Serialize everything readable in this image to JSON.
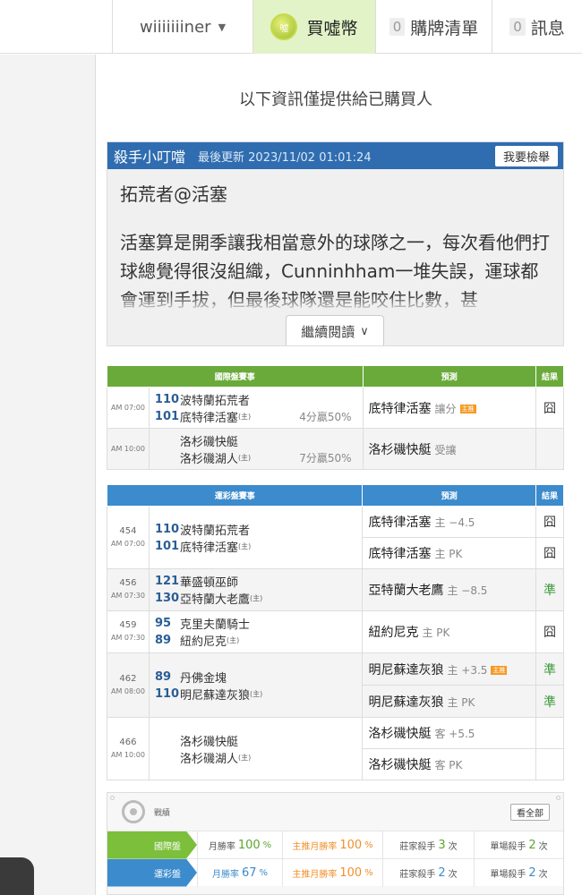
{
  "topbar": {
    "username": "wiiiiiiiner",
    "buy_coin": "買噓幣",
    "coin_icon_text": "噓",
    "list_count": "0",
    "list_label": "購牌清單",
    "msg_count": "0",
    "msg_label": "訊息"
  },
  "notice": "以下資訊僅提供給已購買人",
  "article": {
    "author": "殺手小叮噹",
    "updated": "最後更新 2023/11/02 01:01:24",
    "report": "我要檢舉",
    "title": "拓荒者@活塞",
    "body": "活塞算是開季讓我相當意外的球隊之一，每次看他們打球總覺得很沒組織，Cunninhham一堆失誤，運球都會運到手拔，但最後球隊還是能咬住比數，甚",
    "read_more": "繼續閱讀"
  },
  "intl_table": {
    "headers": [
      "國際盤賽事",
      "預測",
      "結果"
    ],
    "rows": [
      {
        "time": "AM 07:00",
        "away_id": "110",
        "away": "波特蘭拓荒者",
        "home_id": "101",
        "home": "底特律活塞",
        "host": "(主)",
        "odds": "4分贏50%",
        "pick": "底特律活塞",
        "pick_note": "讓分",
        "badge": "主推",
        "result": "囧"
      },
      {
        "time": "AM 10:00",
        "away_id": "",
        "away": "洛杉磯快艇",
        "home_id": "",
        "home": "洛杉磯湖人",
        "host": "(主)",
        "odds": "7分贏50%",
        "pick": "洛杉磯快艇",
        "pick_note": "受讓",
        "badge": "",
        "result": ""
      }
    ]
  },
  "lottery_table": {
    "headers": [
      "運彩盤賽事",
      "預測",
      "結果"
    ],
    "games": [
      {
        "num": "454",
        "time": "AM 07:00",
        "away_id": "110",
        "away": "波特蘭拓荒者",
        "home_id": "101",
        "home": "底特律活塞",
        "host": "(主)",
        "picks": [
          {
            "team": "底特律活塞",
            "note": "主 −4.5",
            "badge": "",
            "result": "囧"
          },
          {
            "team": "底特律活塞",
            "note": "主 PK",
            "badge": "",
            "result": "囧"
          }
        ]
      },
      {
        "num": "456",
        "time": "AM 07:30",
        "away_id": "121",
        "away": "華盛頓巫師",
        "home_id": "130",
        "home": "亞特蘭大老鷹",
        "host": "(主)",
        "picks": [
          {
            "team": "亞特蘭大老鷹",
            "note": "主 −8.5",
            "badge": "",
            "result": "準"
          }
        ]
      },
      {
        "num": "459",
        "time": "AM 07:30",
        "away_id": "95",
        "away": "克里夫蘭騎士",
        "home_id": "89",
        "home": "紐約尼克",
        "host": "(主)",
        "picks": [
          {
            "team": "紐約尼克",
            "note": "主 PK",
            "badge": "",
            "result": "囧"
          }
        ]
      },
      {
        "num": "462",
        "time": "AM 08:00",
        "away_id": "89",
        "away": "丹佛金塊",
        "home_id": "110",
        "home": "明尼蘇達灰狼",
        "host": "(主)",
        "picks": [
          {
            "team": "明尼蘇達灰狼",
            "note": "主 +3.5",
            "badge": "主推",
            "result": "準"
          },
          {
            "team": "明尼蘇達灰狼",
            "note": "主 PK",
            "badge": "",
            "result": "準"
          }
        ]
      },
      {
        "num": "466",
        "time": "AM 10:00",
        "away_id": "",
        "away": "洛杉磯快艇",
        "home_id": "",
        "home": "洛杉磯湖人",
        "host": "(主)",
        "picks": [
          {
            "team": "洛杉磯快艇",
            "note": "客 +5.5",
            "badge": "",
            "result": ""
          },
          {
            "team": "洛杉磯快艇",
            "note": "客 PK",
            "badge": "",
            "result": ""
          }
        ]
      }
    ]
  },
  "stats": {
    "title": "戰績",
    "view_all": "看全部",
    "rows": [
      {
        "label": "國際盤",
        "color": "#7bbf3a",
        "month_label": "月勝率",
        "month_value": "100",
        "month_unit": "%",
        "push_label": "主推月勝率",
        "push_value": "100",
        "push_unit": "%",
        "banker_label": "莊家殺手",
        "banker_value": "3",
        "banker_unit": "次",
        "single_label": "單場殺手",
        "single_value": "2",
        "single_unit": "次"
      },
      {
        "label": "運彩盤",
        "color": "#3b8bcd",
        "month_label": "月勝率",
        "month_value": "67",
        "month_unit": "%",
        "push_label": "主推月勝率",
        "push_value": "100",
        "push_unit": "%",
        "banker_label": "莊家殺手",
        "banker_value": "2",
        "banker_unit": "次",
        "single_label": "單場殺手",
        "single_value": "2",
        "single_unit": "次"
      }
    ]
  },
  "icons": {
    "user_caret": "caret-down-icon",
    "coin": "coin-icon",
    "read_more": "chevron-down-icon",
    "stats": "target-icon"
  }
}
